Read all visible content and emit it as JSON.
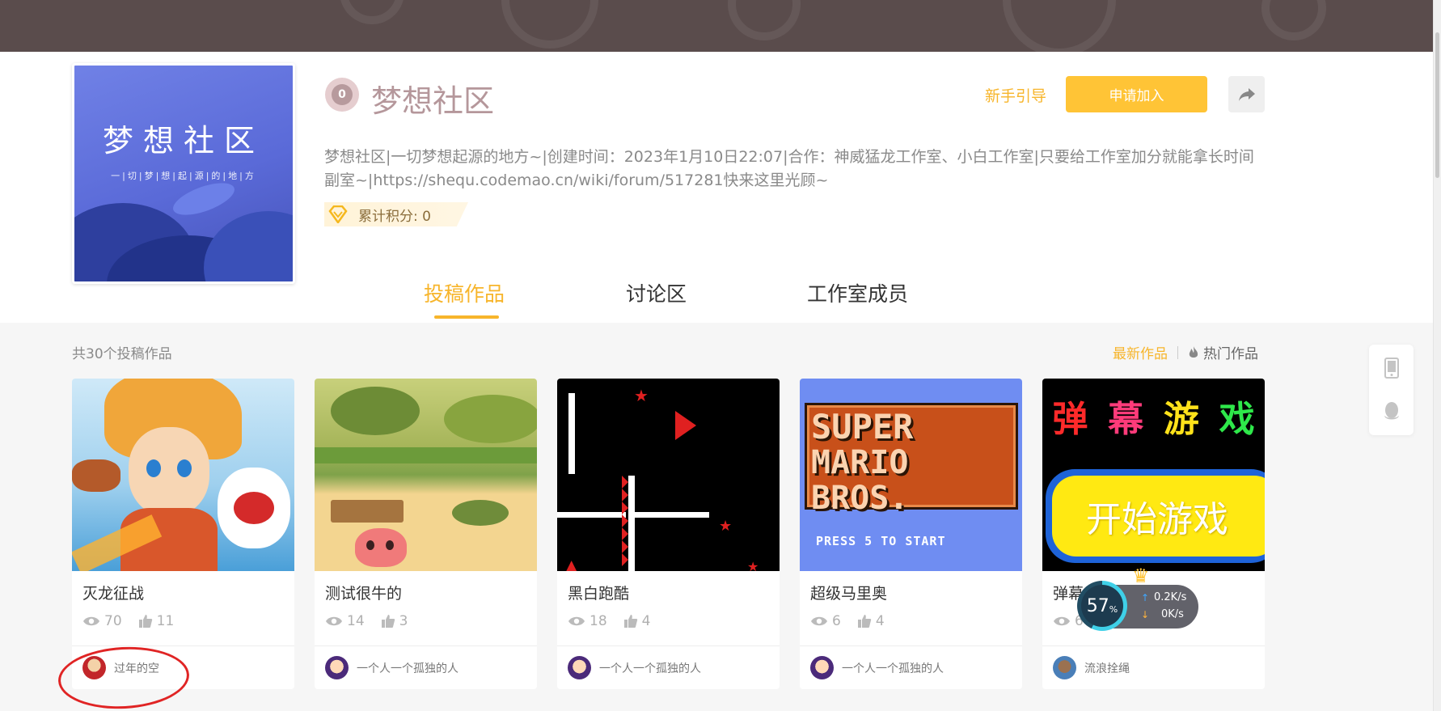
{
  "studio": {
    "cover_title": "梦想社区",
    "cover_subtitle": "一|切|梦|想|起|源|的|地|方",
    "badge_level": "0",
    "name": "梦想社区",
    "description": "梦想社区|一切梦想起源的地方~|创建时间：2023年1月10日22:07|合作：神威猛龙工作室、小白工作室|只要给工作室加分就能拿长时间副室~|https://shequ.codemao.cn/wiki/forum/517281快来这里光顾~",
    "score_label": "累计积分: 0"
  },
  "actions": {
    "guide": "新手引导",
    "join": "申请加入"
  },
  "tabs": [
    {
      "label": "投稿作品",
      "active": true
    },
    {
      "label": "讨论区",
      "active": false
    },
    {
      "label": "工作室成员",
      "active": false
    }
  ],
  "works_count": "共30个投稿作品",
  "sort": {
    "newest": "最新作品",
    "hot": "热门作品"
  },
  "works": [
    {
      "title": "灭龙征战",
      "views": "70",
      "likes": "11",
      "author": "过年的空"
    },
    {
      "title": "测试很牛的",
      "views": "14",
      "likes": "3",
      "author": "一个人一个孤独的人"
    },
    {
      "title": "黑白跑酷",
      "views": "18",
      "likes": "4",
      "author": "一个人一个孤独的人"
    },
    {
      "title": "超级马里奥",
      "views": "6",
      "likes": "4",
      "author": "一个人一个孤独的人"
    },
    {
      "title": "弹幕",
      "views": "6",
      "likes": "",
      "author": "流浪拴绳"
    }
  ],
  "thumb_text": {
    "mario_line1": "SUPER",
    "mario_line2": "MARIO BROS.",
    "mario_press": "PRESS  5  TO  START",
    "danmu_title_chars": [
      "弹",
      "幕",
      "游",
      "戏"
    ],
    "danmu_button": "开始游戏"
  },
  "network_widget": {
    "percent": "57",
    "percent_unit": "%",
    "up_speed": "0.2K/s",
    "down_speed": "0K/s"
  },
  "colors": {
    "accent": "#f7b52b",
    "join_button": "#ffc436",
    "studio_name": "#b5979b",
    "annotation_circle": "#e02424"
  }
}
